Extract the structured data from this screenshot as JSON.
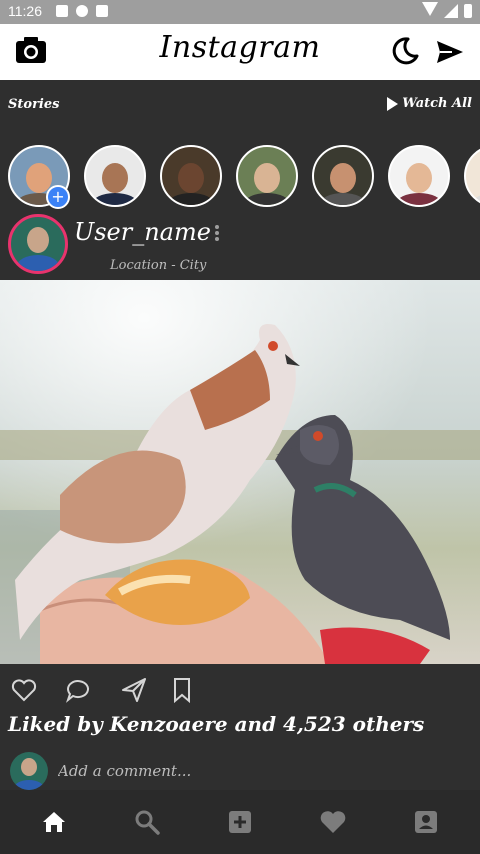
{
  "status": {
    "time": "11:26"
  },
  "header": {
    "brand": "Instagram"
  },
  "stories": {
    "label": "Stories",
    "watch_all": "Watch All"
  },
  "post": {
    "user_name": "User_name",
    "location": "Location - City",
    "likes_text": "Liked by Kenzoaere and 4,523 others"
  },
  "comment": {
    "placeholder": "Add a comment..."
  },
  "colors": {
    "accent_ring": "#e8336d",
    "add_story": "#3b82f6",
    "background": "#2f2f2f"
  },
  "bottom_nav": [
    "home-icon",
    "search-icon",
    "add-box-icon",
    "heart-icon",
    "account-box-icon"
  ]
}
